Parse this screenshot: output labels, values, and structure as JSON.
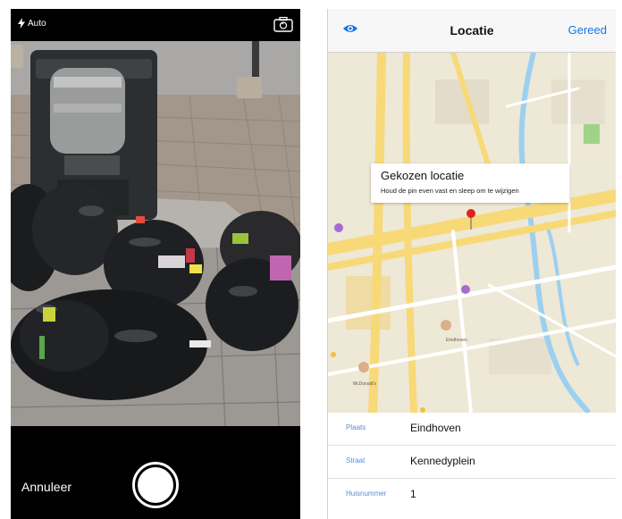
{
  "camera": {
    "flash_label": "Auto",
    "cancel_label": "Annuleer"
  },
  "location": {
    "title": "Locatie",
    "done_label": "Gereed",
    "callout_title": "Gekozen locatie",
    "callout_subtitle": "Houd de pin even vast en sleep om te wijzigen",
    "map_labels": [
      "Eindhoven",
      "McDonald's"
    ]
  },
  "form": {
    "rows": [
      {
        "label": "Plaats",
        "value": "Eindhoven"
      },
      {
        "label": "Straat",
        "value": "Kennedyplein"
      },
      {
        "label": "Huisnummer",
        "value": "1"
      }
    ]
  },
  "colors": {
    "accent": "#1a73e8",
    "pin": "#e02020",
    "water": "#9bd0f0",
    "road": "#f5d77a"
  }
}
